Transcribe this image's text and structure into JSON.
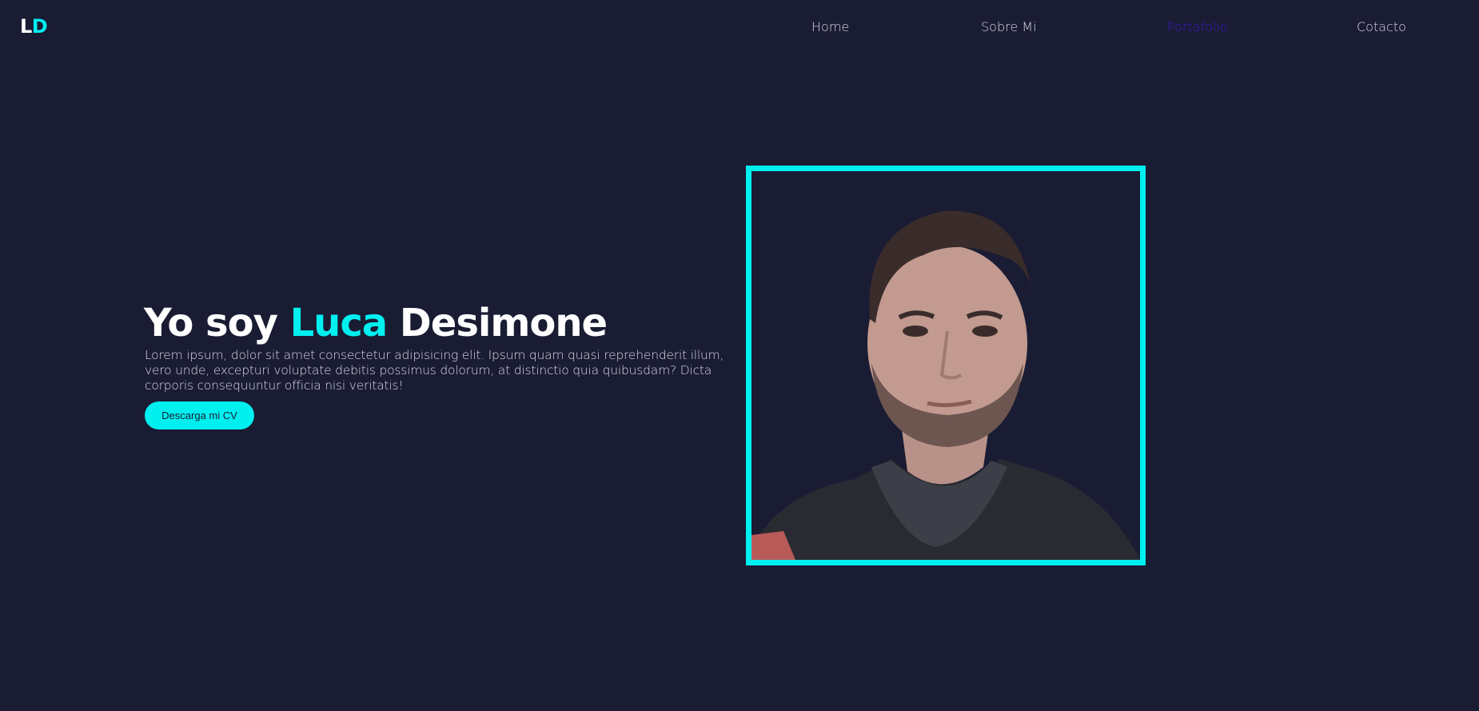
{
  "logo": {
    "first": "L",
    "second": "D"
  },
  "nav": {
    "items": [
      "Home",
      "Sobre Mi",
      "Portafolio",
      "Cotacto"
    ],
    "active": "Portafolio"
  },
  "hero": {
    "title_prefix": "Yo soy ",
    "title_accent": "Luca",
    "title_suffix": " Desimone",
    "description": "Lorem ipsum, dolor sit amet consectetur adipisicing elit. Ipsum quam quasi reprehenderit illum, vero unde, excepturi voluptate debitis possimus dolorum, at distinctio quia quibusdam? Dicta corporis consequuntur officia nisi veritatis!",
    "cv_button": "Descarga mi CV"
  },
  "colors": {
    "background": "#1a1c33",
    "accent": "#00f0f0",
    "nav_active": "#3a18c8",
    "text": "#ffffff"
  }
}
